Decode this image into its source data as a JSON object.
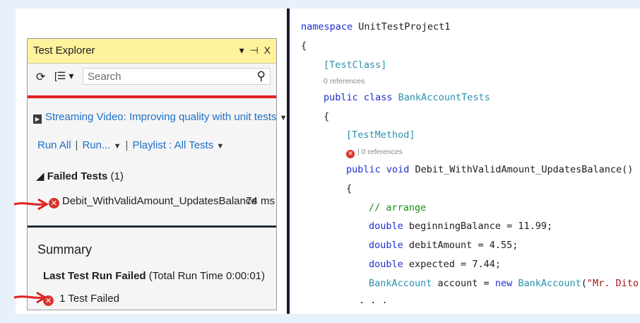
{
  "test_explorer": {
    "title": "Test Explorer",
    "title_controls": "▾ ⊣ X",
    "search_placeholder": "Search",
    "streaming_video": "Streaming Video: Improving quality with unit tests",
    "run_all": "Run All",
    "run": "Run...",
    "playlist": "Playlist : All Tests",
    "failed_tests_label": "Failed Tests",
    "failed_tests_count": "(1)",
    "failed_test": {
      "name": "Debit_WithValidAmount_UpdatesBalance",
      "duration": "74 ms"
    },
    "summary_title": "Summary",
    "last_run_label": "Last Test Run Failed",
    "last_run_time": "(Total Run Time 0:00:01)",
    "tests_failed": "1 Test Failed"
  },
  "code": {
    "line1_kw": "namespace",
    "line1_name": " UnitTestProject1",
    "brace_open": "{",
    "attr_class": "TestClass",
    "refs_class": "0 references",
    "class_kw": "public class",
    "class_name": " BankAccountTests",
    "attr_method": "TestMethod",
    "refs_method": "| 0 references",
    "method_kw": "public void",
    "method_sig": " Debit_WithValidAmount_UpdatesBalance()",
    "comment": "// arrange",
    "var1_kw": "double",
    "var1": " beginningBalance = 11.99;",
    "var2_kw": "double",
    "var2": " debitAmount = 4.55;",
    "var3_kw": "double",
    "var3": " expected = 7.44;",
    "obj_type": "BankAccount",
    "obj_mid": " account = ",
    "obj_new": "new",
    "obj_type2": " BankAccount",
    "obj_paren": "(",
    "obj_str": "\"Mr. Dito\"",
    "obj_end": ",",
    "ellipsis": ". . ."
  },
  "colors": {
    "title_bar": "#fff29d",
    "link": "#1e6fc7",
    "error": "#d9342b",
    "arrow": "#e02020",
    "keyword": "#1c2fcf",
    "type": "#2b91af",
    "comment": "#1a8f1a"
  },
  "icons": [
    "refresh-icon",
    "group-by-icon",
    "search-icon",
    "play-icon",
    "error-icon",
    "arrow-right-icon"
  ]
}
